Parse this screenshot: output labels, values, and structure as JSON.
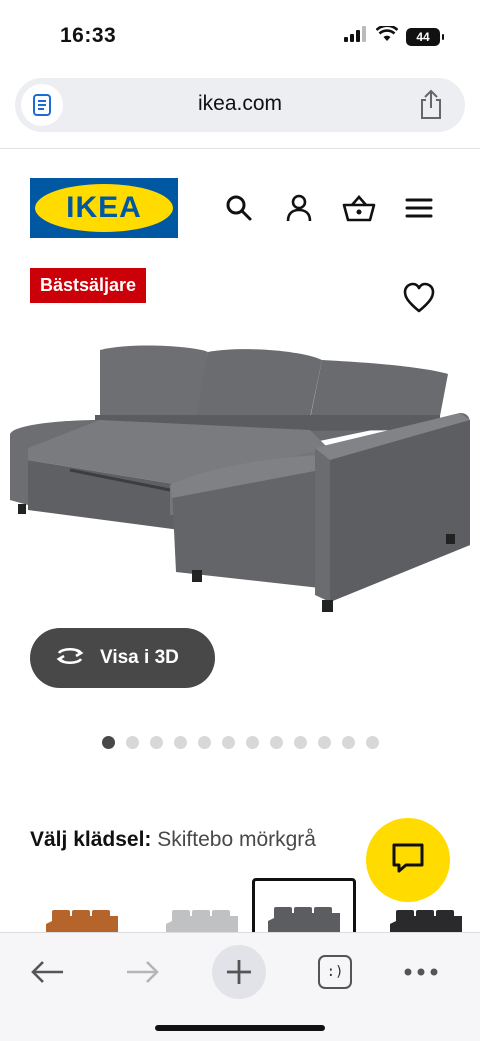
{
  "status_bar": {
    "time": "16:33",
    "battery": "44",
    "icons": [
      "signal-icon",
      "wifi-icon",
      "battery-icon"
    ]
  },
  "browser": {
    "url": "ikea.com",
    "doc_icon": "reader-icon",
    "share_icon": "share-icon"
  },
  "header": {
    "logo_text": "IKEA",
    "icons": [
      "search-icon",
      "user-icon",
      "cart-icon",
      "menu-icon"
    ]
  },
  "product": {
    "badge": "Bästsäljare",
    "view_3d_label": "Visa i 3D",
    "image_count": 12,
    "active_image_index": 0,
    "fabric_label": "Välj klädsel:",
    "fabric_value": "Skiftebo mörkgrå",
    "swatches": [
      {
        "name": "Brun",
        "color": "#b5652b"
      },
      {
        "name": "Ljusgrå",
        "color": "#bfc1c2"
      },
      {
        "name": "Mörkgrå",
        "color": "#5c5d60",
        "selected": true
      },
      {
        "name": "Svart",
        "color": "#2a2a2c"
      }
    ]
  },
  "colors": {
    "ikea_blue": "#0058a3",
    "ikea_yellow": "#ffdb00",
    "badge_red": "#cc0008",
    "button_dark": "#484848"
  },
  "bottom_nav": {
    "items": [
      "back-icon",
      "forward-icon",
      "new-tab-icon",
      "tabs-icon",
      "more-icon"
    ],
    "tabs_glyph": ":)"
  }
}
